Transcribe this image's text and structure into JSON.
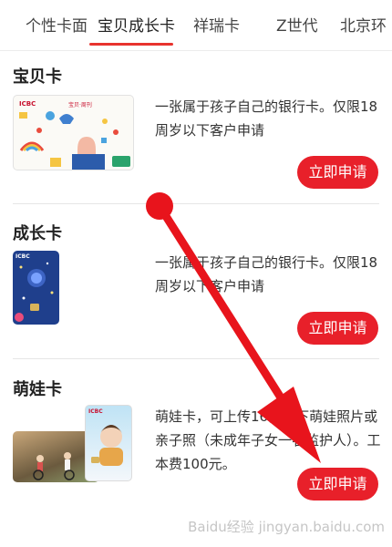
{
  "tabs": [
    {
      "label": "个性卡面",
      "active": false
    },
    {
      "label": "宝贝成长卡",
      "active": true
    },
    {
      "label": "祥瑞卡",
      "active": false
    },
    {
      "label": "Z世代",
      "active": false
    },
    {
      "label": "北京环",
      "active": false
    }
  ],
  "sections": [
    {
      "title": "宝贝卡",
      "description": "一张属于孩子自己的银行卡。仅限18周岁以下客户申请",
      "button": "立即申请",
      "card_brand": "ICBC",
      "card_badge": "宝贝·周刊"
    },
    {
      "title": "成长卡",
      "description": "一张属于孩子自己的银行卡。仅限18周岁以下客户申请",
      "button": "立即申请",
      "card_brand": "ICBC"
    },
    {
      "title": "萌娃卡",
      "description": "萌娃卡，可上传16岁以下萌娃照片或亲子照（未成年子女一名监护人）。工本费100元。",
      "button": "立即申请",
      "card_brand": "ICBC"
    }
  ],
  "watermark": "Baidu经验 jingyan.baidu.com",
  "colors": {
    "accent": "#e8202a",
    "arrow": "#e8141c"
  }
}
